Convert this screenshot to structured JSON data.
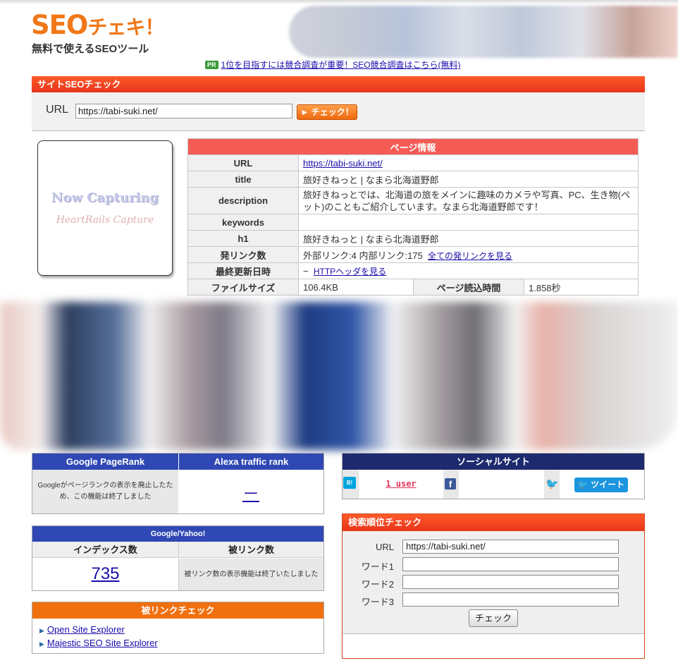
{
  "header": {
    "logo_seo": "SEO",
    "logo_rest": "チェキ！",
    "tagline": "無料で使えるSEOツール",
    "pr_badge": "PR",
    "pr_link": "1位を目指すには競合調査が重要！SEO競合調査はこちら(無料)"
  },
  "site_check": {
    "title": "サイトSEOチェック",
    "url_label": "URL",
    "url_value": "https://tabi-suki.net/",
    "button": "► チェック！"
  },
  "capture": {
    "line1": "Now Capturing",
    "line2": "HeartRails Capture"
  },
  "page_info": {
    "title": "ページ情報",
    "url_label": "URL",
    "url_value": "https://tabi-suki.net/",
    "title_label": "title",
    "title_value": "旅好きねっと | なまら北海道野郎",
    "description_label": "description",
    "description_value": "旅好きねっとでは、北海道の旅をメインに趣味のカメラや写真、PC、生き物(ペット)のこともご紹介しています。なまら北海道野郎です！",
    "keywords_label": "keywords",
    "keywords_value": "",
    "h1_label": "h1",
    "h1_value": "旅好きねっと | なまら北海道野郎",
    "links_label": "発リンク数",
    "links_value": "外部リンク:4  内部リンク:175",
    "links_link": "全ての発リンクを見る",
    "updated_label": "最終更新日時",
    "updated_value": "−",
    "updated_link": "HTTPヘッダを見る",
    "filesize_label": "ファイルサイズ",
    "filesize_value": "106.4KB",
    "loadtime_label": "ページ読込時間",
    "loadtime_value": "1.858秒"
  },
  "rank": {
    "pagerank_title": "Google PageRank",
    "alexa_title": "Alexa traffic rank",
    "pagerank_msg": "Googleがページランクの表示を廃止したため、この機能は終了しました",
    "alexa_value": "－"
  },
  "google_yahoo": {
    "title": "Google/Yahoo!",
    "index_label": "インデックス数",
    "backlink_label": "被リンク数",
    "index_value": "735",
    "backlink_msg": "被リンク数の表示機能は終了いたしました"
  },
  "backlink_check": {
    "title": "被リンクチェック",
    "items": [
      "Open Site Explorer",
      "Majestic SEO Site Explorer"
    ]
  },
  "social": {
    "title": "ソーシャルサイト",
    "hatena_icon": "B!",
    "hatena_count": "1 user",
    "facebook_icon": "f",
    "twitter_icon": "🐦",
    "tweet_button": "ツイート"
  },
  "rank_check": {
    "title": "検索順位チェック",
    "url_label": "URL",
    "url_value": "https://tabi-suki.net/",
    "word1_label": "ワード1",
    "word2_label": "ワード2",
    "word3_label": "ワード3",
    "button": "チェック"
  }
}
